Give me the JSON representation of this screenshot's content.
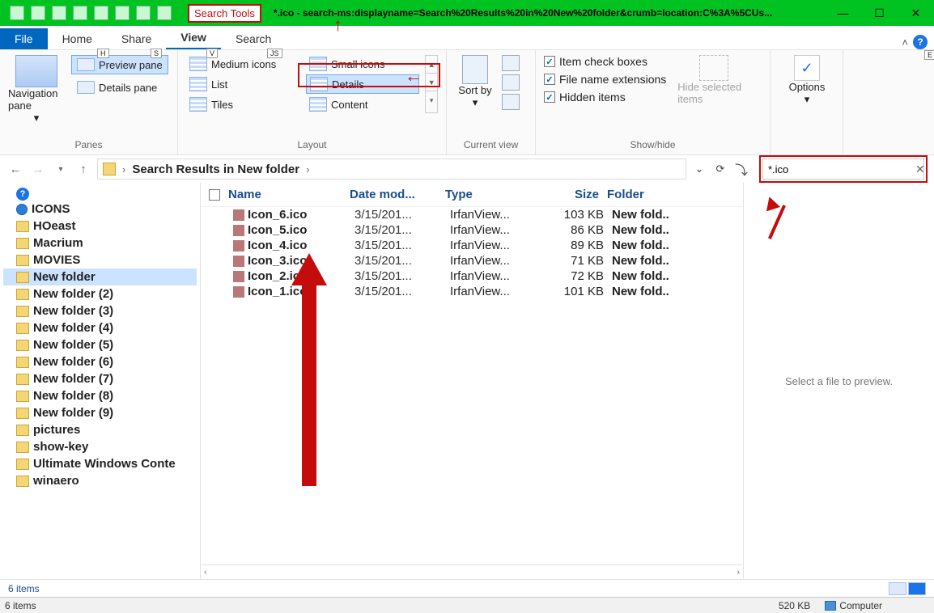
{
  "window": {
    "search_tools_label": "Search Tools",
    "title": "*.ico - search-ms:displayname=Search%20Results%20in%20New%20folder&crumb=location:C%3A%5CUs...",
    "minimize": "—",
    "maximize": "☐",
    "close": "✕"
  },
  "tabs": {
    "file": "File",
    "home": "Home",
    "home_key": "H",
    "share": "Share",
    "share_key": "S",
    "view": "View",
    "view_key": "V",
    "search": "Search",
    "search_key": "JS",
    "help_letter": "?",
    "help_key": "E"
  },
  "ribbon": {
    "panes": {
      "label": "Panes",
      "nav": "Navigation pane",
      "preview": "Preview pane",
      "details": "Details pane"
    },
    "layout": {
      "label": "Layout",
      "items": [
        "Medium icons",
        "Small icons",
        "List",
        "Details",
        "Tiles",
        "Content"
      ],
      "selected": "Details"
    },
    "current_view": {
      "label": "Current view",
      "sort": "Sort by"
    },
    "show_hide": {
      "label": "Show/hide",
      "checks": [
        "Item check boxes",
        "File name extensions",
        "Hidden items"
      ],
      "hide_selected": "Hide selected items"
    },
    "options": {
      "label": "Options"
    }
  },
  "nav": {
    "breadcrumb": "Search Results in New folder",
    "search_value": "*.ico"
  },
  "tree": {
    "items": [
      {
        "label": "ICONS",
        "bold": true,
        "type": "root"
      },
      {
        "label": "HOeast"
      },
      {
        "label": "Macrium"
      },
      {
        "label": "MOVIES"
      },
      {
        "label": "New folder",
        "selected": true
      },
      {
        "label": "New folder (2)"
      },
      {
        "label": "New folder (3)"
      },
      {
        "label": "New folder (4)"
      },
      {
        "label": "New folder (5)"
      },
      {
        "label": "New folder (6)"
      },
      {
        "label": "New folder (7)"
      },
      {
        "label": "New folder (8)"
      },
      {
        "label": "New folder (9)"
      },
      {
        "label": "pictures"
      },
      {
        "label": "show-key"
      },
      {
        "label": "Ultimate Windows Conte"
      },
      {
        "label": "winaero"
      }
    ]
  },
  "columns": {
    "name": "Name",
    "date": "Date mod...",
    "type": "Type",
    "size": "Size",
    "folder": "Folder"
  },
  "files": [
    {
      "name": "Icon_6.ico",
      "date": "3/15/201...",
      "type": "IrfanView...",
      "size": "103 KB",
      "folder": "New fold.."
    },
    {
      "name": "Icon_5.ico",
      "date": "3/15/201...",
      "type": "IrfanView...",
      "size": "86 KB",
      "folder": "New fold.."
    },
    {
      "name": "Icon_4.ico",
      "date": "3/15/201...",
      "type": "IrfanView...",
      "size": "89 KB",
      "folder": "New fold.."
    },
    {
      "name": "Icon_3.ico",
      "date": "3/15/201...",
      "type": "IrfanView...",
      "size": "71 KB",
      "folder": "New fold.."
    },
    {
      "name": "Icon_2.ico",
      "date": "3/15/201...",
      "type": "IrfanView...",
      "size": "72 KB",
      "folder": "New fold.."
    },
    {
      "name": "Icon_1.ico",
      "date": "3/15/201...",
      "type": "IrfanView...",
      "size": "101 KB",
      "folder": "New fold.."
    }
  ],
  "preview": {
    "empty": "Select a file to preview."
  },
  "status": {
    "items": "6 items",
    "items2": "6 items",
    "size": "520 KB",
    "computer": "Computer"
  }
}
